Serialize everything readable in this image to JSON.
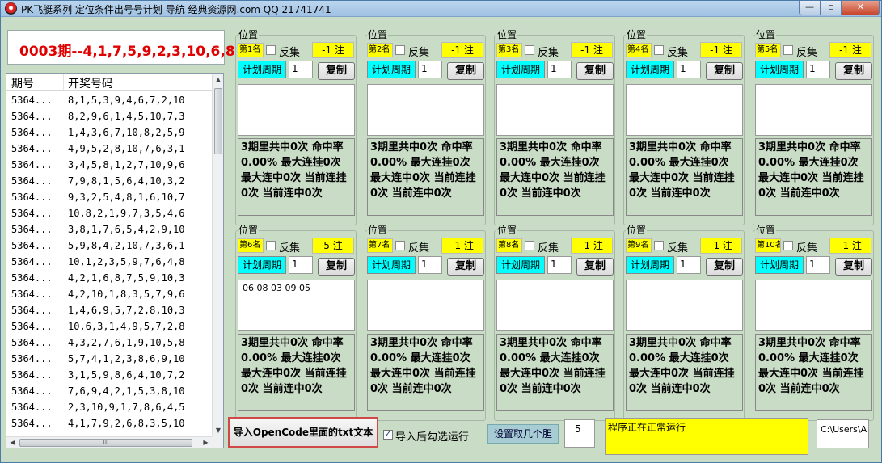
{
  "window": {
    "title": "PK飞艇系列 定位条件出号号计划 导航 经典资源网.com QQ 21741741",
    "min_glyph": "—",
    "max_glyph": "▫",
    "close_glyph": "✕"
  },
  "current_period": "0003期--4,1,7,5,9,2,3,10,6,8",
  "list": {
    "col_period": "期号",
    "col_numbers": "开奖号码",
    "rows": [
      {
        "period": "5364...",
        "numbers": "8,1,5,3,9,4,6,7,2,10"
      },
      {
        "period": "5364...",
        "numbers": "8,2,9,6,1,4,5,10,7,3"
      },
      {
        "period": "5364...",
        "numbers": "1,4,3,6,7,10,8,2,5,9"
      },
      {
        "period": "5364...",
        "numbers": "4,9,5,2,8,10,7,6,3,1"
      },
      {
        "period": "5364...",
        "numbers": "3,4,5,8,1,2,7,10,9,6"
      },
      {
        "period": "5364...",
        "numbers": "7,9,8,1,5,6,4,10,3,2"
      },
      {
        "period": "5364...",
        "numbers": "9,3,2,5,4,8,1,6,10,7"
      },
      {
        "period": "5364...",
        "numbers": "10,8,2,1,9,7,3,5,4,6"
      },
      {
        "period": "5364...",
        "numbers": "3,8,1,7,6,5,4,2,9,10"
      },
      {
        "period": "5364...",
        "numbers": "5,9,8,4,2,10,7,3,6,1"
      },
      {
        "period": "5364...",
        "numbers": "10,1,2,3,5,9,7,6,4,8"
      },
      {
        "period": "5364...",
        "numbers": "4,2,1,6,8,7,5,9,10,3"
      },
      {
        "period": "5364...",
        "numbers": "4,2,10,1,8,3,5,7,9,6"
      },
      {
        "period": "5364...",
        "numbers": "1,4,6,9,5,7,2,8,10,3"
      },
      {
        "period": "5364...",
        "numbers": "10,6,3,1,4,9,5,7,2,8"
      },
      {
        "period": "5364...",
        "numbers": "4,3,2,7,6,1,9,10,5,8"
      },
      {
        "period": "5364...",
        "numbers": "5,7,4,1,2,3,8,6,9,10"
      },
      {
        "period": "5364...",
        "numbers": "3,1,5,9,8,6,4,10,7,2"
      },
      {
        "period": "5364...",
        "numbers": "7,6,9,4,2,1,5,3,8,10"
      },
      {
        "period": "5364...",
        "numbers": "2,3,10,9,1,7,8,6,4,5"
      },
      {
        "period": "5364...",
        "numbers": "4,1,7,9,2,6,8,3,5,10"
      }
    ],
    "hscroll_grip": "III"
  },
  "groups_common": {
    "legend": "位置",
    "reverse_label": "反集",
    "cycle_label": "计划周期",
    "cycle_value": "1",
    "copy_label": "复制",
    "stat_text": "3期里共中0次 命中率0.00% 最大连挂0次 最大连中0次 当前连挂0次 当前连中0次"
  },
  "groups": [
    {
      "rank": "第1名",
      "zhu": "-1 注",
      "result": ""
    },
    {
      "rank": "第2名",
      "zhu": "-1 注",
      "result": ""
    },
    {
      "rank": "第3名",
      "zhu": "-1 注",
      "result": ""
    },
    {
      "rank": "第4名",
      "zhu": "-1 注",
      "result": ""
    },
    {
      "rank": "第5名",
      "zhu": "-1 注",
      "result": ""
    },
    {
      "rank": "第6名",
      "zhu": "5 注",
      "result": "06 08 03 09 05"
    },
    {
      "rank": "第7名",
      "zhu": "-1 注",
      "result": ""
    },
    {
      "rank": "第8名",
      "zhu": "-1 注",
      "result": ""
    },
    {
      "rank": "第9名",
      "zhu": "-1 注",
      "result": ""
    },
    {
      "rank": "第10名",
      "zhu": "-1 注",
      "result": ""
    }
  ],
  "bottom": {
    "import_label": "导入OpenCode里面的txt文本",
    "after_import_label": "导入后勾选运行",
    "after_import_checked": true,
    "dan_label": "设置取几个胆",
    "dan_value": "5",
    "status": "程序正在正常运行",
    "path": "C:\\Users\\A"
  },
  "colors": {
    "background": "#c9dcc6",
    "highlight_yellow": "#ffff00",
    "cycle_cyan": "#00ffff",
    "period_red": "#e00000"
  }
}
